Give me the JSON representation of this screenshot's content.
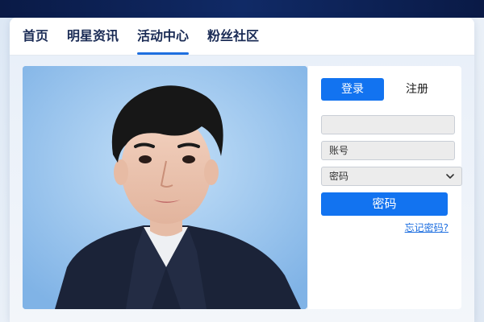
{
  "nav": {
    "items": [
      {
        "label": "首页",
        "active": false
      },
      {
        "label": "明星资讯",
        "active": false
      },
      {
        "label": "活动中心",
        "active": true
      },
      {
        "label": "粉丝社区",
        "active": false
      }
    ]
  },
  "login": {
    "tabs": {
      "login_label": "登录",
      "register_label": "注册"
    },
    "fields": {
      "first_placeholder": "",
      "account_placeholder": "账号",
      "password_select_value": "密码"
    },
    "submit_label": "密码",
    "forgot_label": "忘记密码?"
  },
  "colors": {
    "accent": "#1273f0",
    "nav_text": "#1a2b55",
    "link": "#1e6fe0"
  },
  "icons": {
    "select_arrow": "chevron-down-icon"
  }
}
